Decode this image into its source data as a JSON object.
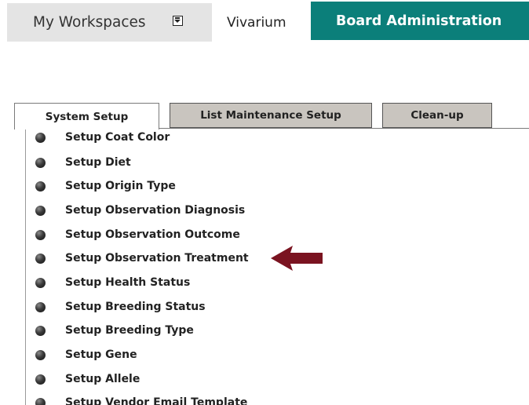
{
  "topnav": {
    "workspaces_label": "My Workspaces",
    "vivarium_label": "Vivarium",
    "board_label": "Board Administration",
    "board_color": "#0b7f7a"
  },
  "tabs": [
    {
      "label": "System Setup",
      "active": true
    },
    {
      "label": "List Maintenance Setup",
      "active": false
    },
    {
      "label": "Clean-up",
      "active": false
    }
  ],
  "menu": {
    "items": [
      "Setup Coat Color",
      "Setup Diet",
      "Setup Origin Type",
      "Setup Observation Diagnosis",
      "Setup Observation Outcome",
      "Setup Observation Treatment",
      "Setup Health Status",
      "Setup Breeding Status",
      "Setup Breeding Type",
      "Setup Gene",
      "Setup Allele",
      "Setup Vendor Email Template"
    ]
  },
  "annotation": {
    "arrow_color": "#7a1320",
    "points_to": "Setup Observation Treatment"
  }
}
